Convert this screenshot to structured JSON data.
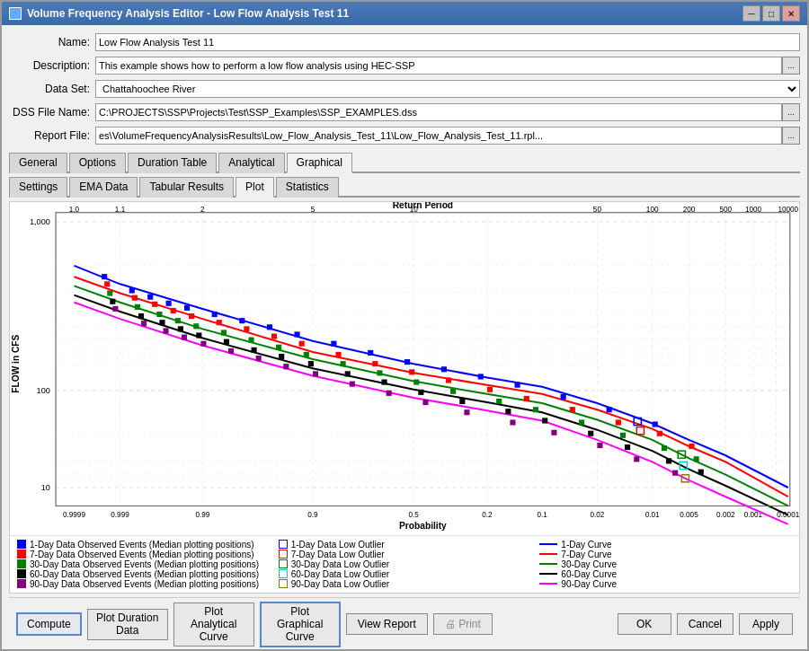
{
  "window": {
    "title": "Volume Frequency Analysis Editor - Low Flow Analysis Test 11",
    "icon": "chart-icon"
  },
  "form": {
    "name_label": "Name:",
    "name_value": "Low Flow Analysis Test 11",
    "description_label": "Description:",
    "description_value": "This example shows how to perform a low flow analysis using HEC-SSP",
    "dataset_label": "Data Set:",
    "dataset_value": "Chattahoochee River",
    "dss_label": "DSS File Name:",
    "dss_value": "C:\\PROJECTS\\SSP\\Projects\\Test\\SSP_Examples\\SSP_EXAMPLES.dss",
    "report_label": "Report File:",
    "report_value": "es\\VolumeFrequencyAnalysisResults\\Low_Flow_Analysis_Test_11\\Low_Flow_Analysis_Test_11.rpl..."
  },
  "tabs": {
    "main": [
      {
        "label": "General",
        "active": false
      },
      {
        "label": "Options",
        "active": false
      },
      {
        "label": "Duration Table",
        "active": false
      },
      {
        "label": "Analytical",
        "active": false
      },
      {
        "label": "Graphical",
        "active": true
      }
    ],
    "sub": [
      {
        "label": "Settings",
        "active": false
      },
      {
        "label": "EMA Data",
        "active": false
      },
      {
        "label": "Tabular Results",
        "active": false
      },
      {
        "label": "Plot",
        "active": true
      },
      {
        "label": "Statistics",
        "active": false
      }
    ]
  },
  "chart": {
    "title_top": "Return Period",
    "title_left": "FLOW in CFS",
    "title_bottom": "Probability",
    "x_labels_top": [
      "1.0",
      "1.1",
      "2",
      "5",
      "10",
      "50",
      "100",
      "200",
      "500",
      "1000",
      "10000"
    ],
    "x_labels_bottom": [
      "0.9999",
      "0.999",
      "0.99",
      "0.9",
      "0.5",
      "0.2",
      "0.1",
      "0.02",
      "0.01",
      "0.005",
      "0.002",
      "0.001",
      "0.0001"
    ],
    "y_labels": [
      "10",
      "100",
      "1,000"
    ]
  },
  "legend": {
    "items": [
      {
        "type": "square",
        "color": "#0000ff",
        "label": "1-Day Data Observed Events (Median plotting positions)"
      },
      {
        "type": "square",
        "color": "#ff0000",
        "label": "7-Day Data Observed Events (Median plotting positions)"
      },
      {
        "type": "square",
        "color": "#008000",
        "label": "30-Day Data Observed Events (Median plotting positions)"
      },
      {
        "type": "square",
        "color": "#000000",
        "label": "60-Day Data Observed Events (Median plotting positions)"
      },
      {
        "type": "square",
        "color": "#800080",
        "label": "90-Day Data Observed Events (Median plotting positions)"
      },
      {
        "type": "square_outline",
        "color": "#0000ff",
        "label": "1-Day Data Low Outlier"
      },
      {
        "type": "square_outline",
        "color": "#ff0000",
        "label": "7-Day Data Low Outlier"
      },
      {
        "type": "square_outline",
        "color": "#008000",
        "label": "30-Day Data Low Outlier"
      },
      {
        "type": "square_outline",
        "color": "#00cccc",
        "label": "60-Day Data Low Outlier"
      },
      {
        "type": "square_outline",
        "color": "#808000",
        "label": "90-Day Data Low Outlier"
      },
      {
        "type": "line",
        "color": "#0000ff",
        "label": "1-Day Curve"
      },
      {
        "type": "line",
        "color": "#ff0000",
        "label": "7-Day Curve"
      },
      {
        "type": "line",
        "color": "#008000",
        "label": "30-Day Curve"
      },
      {
        "type": "line",
        "color": "#000000",
        "label": "60-Day Curve"
      },
      {
        "type": "line",
        "color": "#ff00ff",
        "label": "90-Day Curve"
      }
    ]
  },
  "buttons": {
    "compute": "Compute",
    "plot_duration_data": "Plot Duration\nData",
    "plot_analytical_curve": "Plot Analytical\nCurve",
    "plot_graphical_curve": "Plot Graphical\nCurve",
    "view_report": "View Report",
    "print": "🖨 Print",
    "ok": "OK",
    "cancel": "Cancel",
    "apply": "Apply"
  }
}
